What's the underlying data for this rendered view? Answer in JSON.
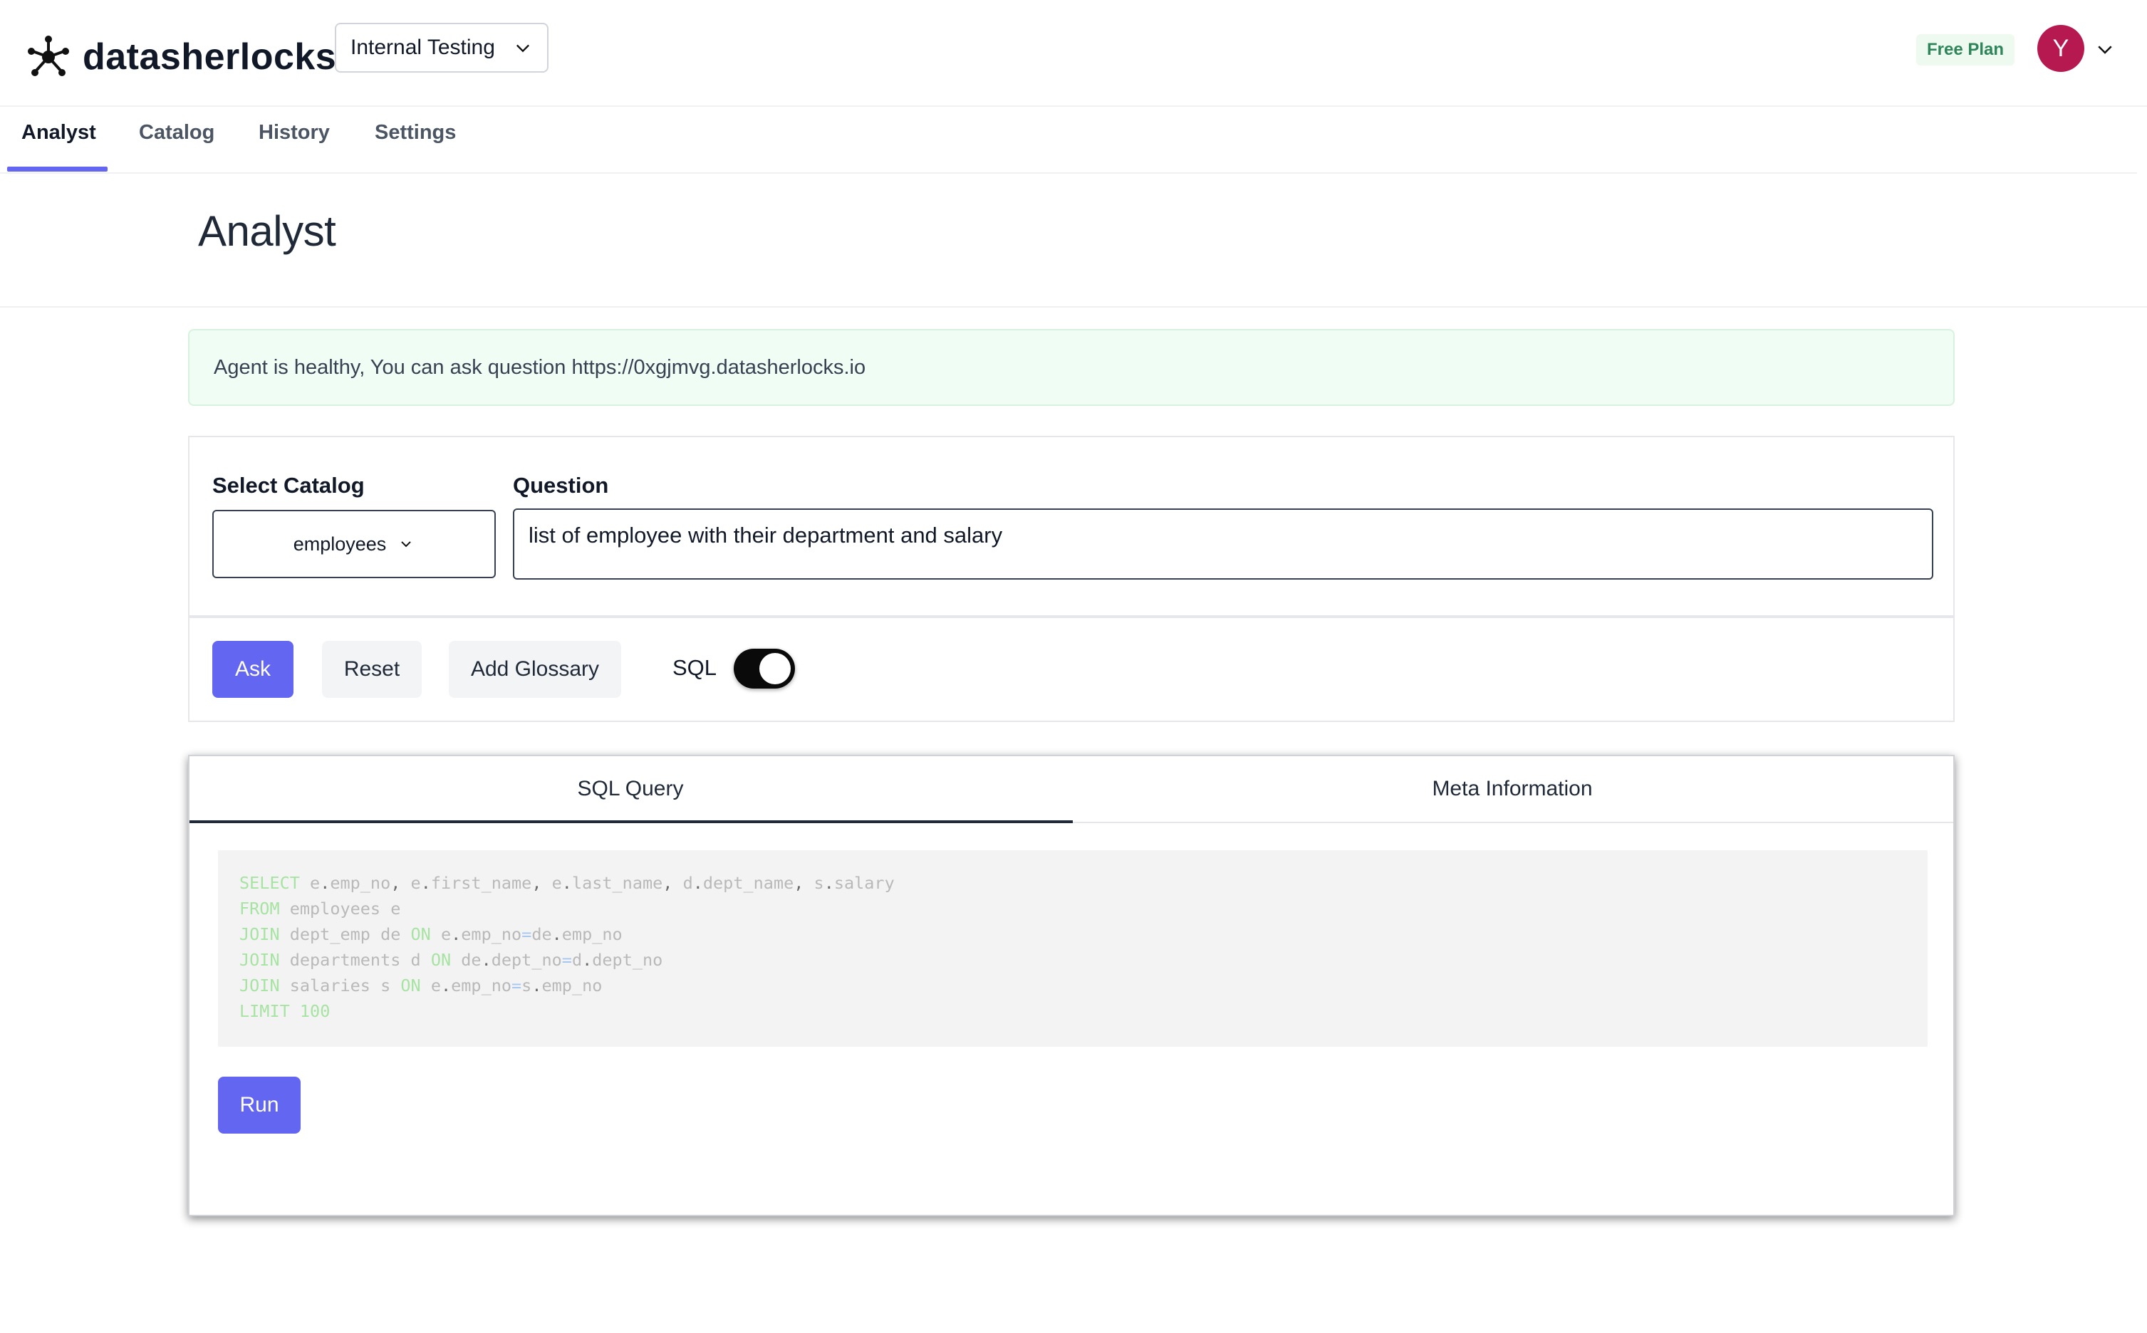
{
  "header": {
    "brand": "datasherlocks",
    "workspace": "Internal Testing",
    "plan_badge": "Free Plan",
    "avatar_initial": "Y"
  },
  "nav": {
    "tabs": [
      {
        "label": "Analyst",
        "active": true
      },
      {
        "label": "Catalog",
        "active": false
      },
      {
        "label": "History",
        "active": false
      },
      {
        "label": "Settings",
        "active": false
      }
    ]
  },
  "page": {
    "title": "Analyst"
  },
  "alert": {
    "message": "Agent is healthy, You can ask question https://0xgjmvg.datasherlocks.io",
    "color": "#f0fdf4"
  },
  "form": {
    "catalog_label": "Select Catalog",
    "catalog_value": "employees",
    "question_label": "Question",
    "question_value": "list of employee with their department and salary"
  },
  "actions": {
    "ask_label": "Ask",
    "reset_label": "Reset",
    "glossary_label": "Add Glossary",
    "sql_label": "SQL",
    "sql_toggle_on": true
  },
  "result": {
    "tabs": [
      {
        "label": "SQL Query",
        "active": true
      },
      {
        "label": "Meta Information",
        "active": false
      }
    ],
    "sql_lines": [
      "SELECT e.emp_no, e.first_name, e.last_name, d.dept_name, s.salary",
      "FROM employees e",
      "JOIN dept_emp de ON e.emp_no=de.emp_no",
      "JOIN departments d ON de.dept_no=d.dept_no",
      "JOIN salaries s ON e.emp_no=s.emp_no",
      "LIMIT 100"
    ],
    "run_label": "Run"
  },
  "colors": {
    "accent": "#6366f1",
    "avatar": "#b5194f",
    "plan_badge_text": "#2f855a"
  }
}
